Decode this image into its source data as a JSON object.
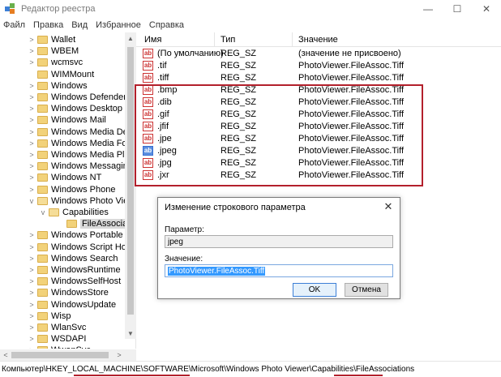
{
  "window": {
    "title": "Редактор реестра"
  },
  "menu": [
    "Файл",
    "Правка",
    "Вид",
    "Избранное",
    "Справка"
  ],
  "tree": [
    {
      "label": "Wallet",
      "depth": 1,
      "expander": ">",
      "open": false
    },
    {
      "label": "WBEM",
      "depth": 1,
      "expander": ">",
      "open": false
    },
    {
      "label": "wcmsvc",
      "depth": 1,
      "expander": ">",
      "open": false
    },
    {
      "label": "WIMMount",
      "depth": 1,
      "expander": "",
      "open": false
    },
    {
      "label": "Windows",
      "depth": 1,
      "expander": ">",
      "open": false
    },
    {
      "label": "Windows Defender",
      "depth": 1,
      "expander": ">",
      "open": false
    },
    {
      "label": "Windows Desktop Se",
      "depth": 1,
      "expander": ">",
      "open": false
    },
    {
      "label": "Windows Mail",
      "depth": 1,
      "expander": ">",
      "open": false
    },
    {
      "label": "Windows Media Devi",
      "depth": 1,
      "expander": ">",
      "open": false
    },
    {
      "label": "Windows Media Four",
      "depth": 1,
      "expander": ">",
      "open": false
    },
    {
      "label": "Windows Media Play",
      "depth": 1,
      "expander": ">",
      "open": false
    },
    {
      "label": "Windows Messaging",
      "depth": 1,
      "expander": ">",
      "open": false
    },
    {
      "label": "Windows NT",
      "depth": 1,
      "expander": ">",
      "open": false
    },
    {
      "label": "Windows Phone",
      "depth": 1,
      "expander": ">",
      "open": false
    },
    {
      "label": "Windows Photo View",
      "depth": 1,
      "expander": "v",
      "open": true
    },
    {
      "label": "Capabilities",
      "depth": 2,
      "expander": "v",
      "open": true
    },
    {
      "label": "FileAssociatio",
      "depth": 3,
      "expander": "",
      "open": false,
      "selected": true
    },
    {
      "label": "Windows Portable De",
      "depth": 1,
      "expander": ">",
      "open": false
    },
    {
      "label": "Windows Script Host",
      "depth": 1,
      "expander": ">",
      "open": false
    },
    {
      "label": "Windows Search",
      "depth": 1,
      "expander": ">",
      "open": false
    },
    {
      "label": "WindowsRuntime",
      "depth": 1,
      "expander": ">",
      "open": false
    },
    {
      "label": "WindowsSelfHost",
      "depth": 1,
      "expander": ">",
      "open": false
    },
    {
      "label": "WindowsStore",
      "depth": 1,
      "expander": ">",
      "open": false
    },
    {
      "label": "WindowsUpdate",
      "depth": 1,
      "expander": ">",
      "open": false
    },
    {
      "label": "Wisp",
      "depth": 1,
      "expander": ">",
      "open": false
    },
    {
      "label": "WlanSvc",
      "depth": 1,
      "expander": ">",
      "open": false
    },
    {
      "label": "WSDAPI",
      "depth": 1,
      "expander": ">",
      "open": false
    },
    {
      "label": "WwanSvc",
      "depth": 1,
      "expander": ">",
      "open": false
    }
  ],
  "list": {
    "columns": {
      "name": "Имя",
      "type": "Тип",
      "value": "Значение"
    },
    "rows": [
      {
        "name": "(По умолчанию)",
        "type": "REG_SZ",
        "value": "(значение не присвоено)",
        "icon": "red"
      },
      {
        "name": ".tif",
        "type": "REG_SZ",
        "value": "PhotoViewer.FileAssoc.Tiff",
        "icon": "red"
      },
      {
        "name": ".tiff",
        "type": "REG_SZ",
        "value": "PhotoViewer.FileAssoc.Tiff",
        "icon": "red"
      },
      {
        "name": ".bmp",
        "type": "REG_SZ",
        "value": "PhotoViewer.FileAssoc.Tiff",
        "icon": "red"
      },
      {
        "name": ".dib",
        "type": "REG_SZ",
        "value": "PhotoViewer.FileAssoc.Tiff",
        "icon": "red"
      },
      {
        "name": ".gif",
        "type": "REG_SZ",
        "value": "PhotoViewer.FileAssoc.Tiff",
        "icon": "red"
      },
      {
        "name": ".jfif",
        "type": "REG_SZ",
        "value": "PhotoViewer.FileAssoc.Tiff",
        "icon": "red"
      },
      {
        "name": ".jpe",
        "type": "REG_SZ",
        "value": "PhotoViewer.FileAssoc.Tiff",
        "icon": "red"
      },
      {
        "name": ".jpeg",
        "type": "REG_SZ",
        "value": "PhotoViewer.FileAssoc.Tiff",
        "icon": "blue"
      },
      {
        "name": ".jpg",
        "type": "REG_SZ",
        "value": "PhotoViewer.FileAssoc.Tiff",
        "icon": "red"
      },
      {
        "name": ".jxr",
        "type": "REG_SZ",
        "value": "PhotoViewer.FileAssoc.Tiff",
        "icon": "red"
      }
    ]
  },
  "dialog": {
    "title": "Изменение строкового параметра",
    "param_label": "Параметр:",
    "param_value": "jpeg",
    "value_label": "Значение:",
    "value_value": "PhotoViewer.FileAssoc.Tiff",
    "ok": "OK",
    "cancel": "Отмена"
  },
  "status": {
    "path": "Компьютер\\HKEY_LOCAL_MACHINE\\SOFTWARE\\Microsoft\\Windows Photo Viewer\\Capabilities\\FileAssociations"
  },
  "icons": {
    "string_value": "ab",
    "close": "✕",
    "minimize": "—",
    "maximize": "☐"
  },
  "colors": {
    "highlight": "#b3202c",
    "selection": "#3399ff",
    "folder": "#f2d27a"
  }
}
